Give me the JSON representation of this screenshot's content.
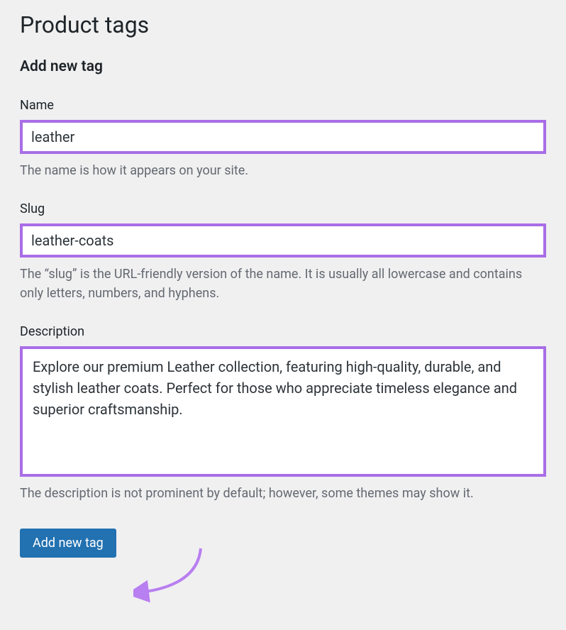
{
  "page": {
    "title": "Product tags"
  },
  "form": {
    "section_title": "Add new tag",
    "name": {
      "label": "Name",
      "value": "leather",
      "help": "The name is how it appears on your site."
    },
    "slug": {
      "label": "Slug",
      "value": "leather-coats",
      "help": "The “slug” is the URL-friendly version of the name. It is usually all lowercase and contains only letters, numbers, and hyphens."
    },
    "description": {
      "label": "Description",
      "value": "Explore our premium Leather collection, featuring high-quality, durable, and stylish leather coats. Perfect for those who appreciate timeless elegance and superior craftsmanship.",
      "help": "The description is not prominent by default; however, some themes may show it."
    },
    "submit_label": "Add new tag"
  },
  "annotation": {
    "highlight_color": "#a96ee6",
    "arrow_color": "#b87ff0"
  }
}
